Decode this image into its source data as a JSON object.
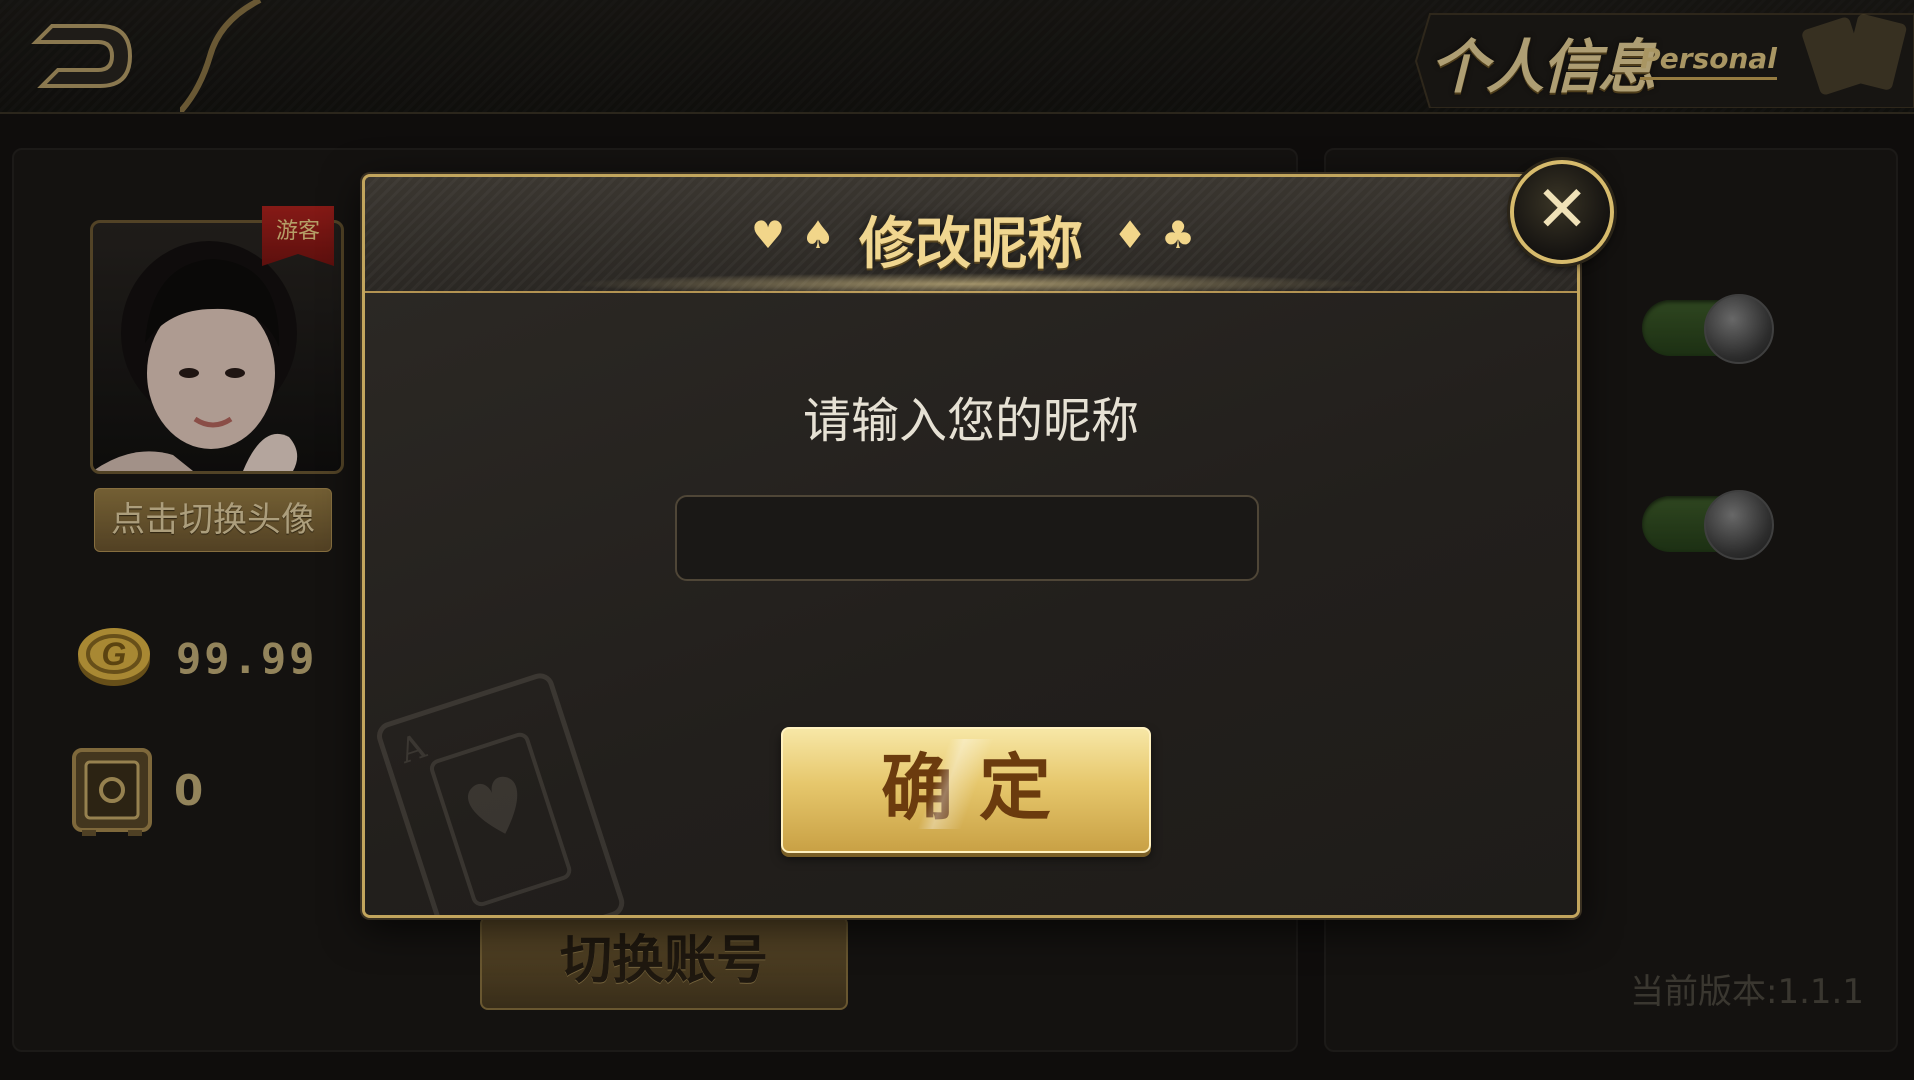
{
  "header": {
    "title_cn": "个人信息",
    "title_en": "Personal",
    "back_icon": "back-arrow-icon"
  },
  "profile": {
    "guest_badge": "游客",
    "switch_avatar_label": "点击切换头像",
    "coins": "99.99",
    "safe_box": "0",
    "switch_account_label": "切换账号"
  },
  "settings": {
    "toggles": [
      {
        "state": "on"
      },
      {
        "state": "on"
      }
    ],
    "version": "当前版本:1.1.1"
  },
  "dialog": {
    "title": "修改昵称",
    "suits_left": [
      "♥",
      "♠"
    ],
    "suits_right": [
      "♦",
      "♣"
    ],
    "prompt": "请输入您的昵称",
    "input_value": "",
    "input_placeholder": "",
    "confirm_label": "确定",
    "close_icon": "close-icon"
  },
  "colors": {
    "gold": "#c2a55d",
    "gold_light": "#f0d690",
    "background": "#141210",
    "toggle_on": "#3f5e2b"
  }
}
